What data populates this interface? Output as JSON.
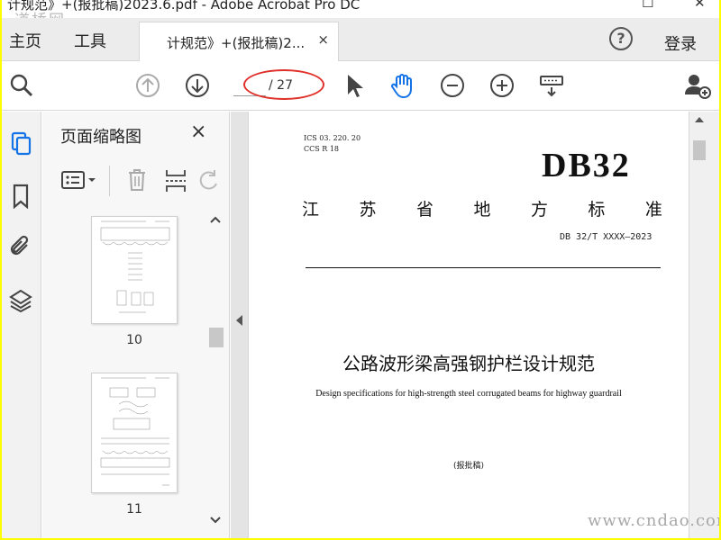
{
  "window": {
    "title": "计规范》+(报批稿)2023.6.pdf - Adobe Acrobat Pro DC",
    "watermark_top": "道桥网",
    "watermark_bottom": "www.cndao.com"
  },
  "menu": {
    "home": "主页",
    "tools": "工具",
    "sign_in": "登录"
  },
  "tab": {
    "label": "计规范》+(报批稿)2...",
    "close": "×"
  },
  "toolbar": {
    "current_page": "",
    "page_total": "/ 27",
    "icons": [
      "search-icon",
      "page-up-icon",
      "page-down-icon",
      "select-cursor-icon",
      "hand-tool-icon",
      "zoom-out-icon",
      "zoom-in-icon",
      "read-mode-icon",
      "add-user-icon"
    ],
    "highlight_color": "#e0302a",
    "accent_color": "#1473e6"
  },
  "thumbnail_panel": {
    "title": "页面缩略图",
    "close": "×",
    "thumbnails": [
      {
        "page_label": "10"
      },
      {
        "page_label": "11"
      }
    ]
  },
  "document": {
    "ics": "ICS  03. 220. 20",
    "ccs": "CCS  R  18",
    "standard_code": "DB32",
    "standard_level": "江苏省地方标准",
    "standard_number": "DB 32/T XXXX—2023",
    "title_cn": "公路波形梁高强钢护栏设计规范",
    "title_en": "Design specifications for high-strength steel corrugated beams for highway guardrail",
    "draft_note": "(报批稿)"
  }
}
